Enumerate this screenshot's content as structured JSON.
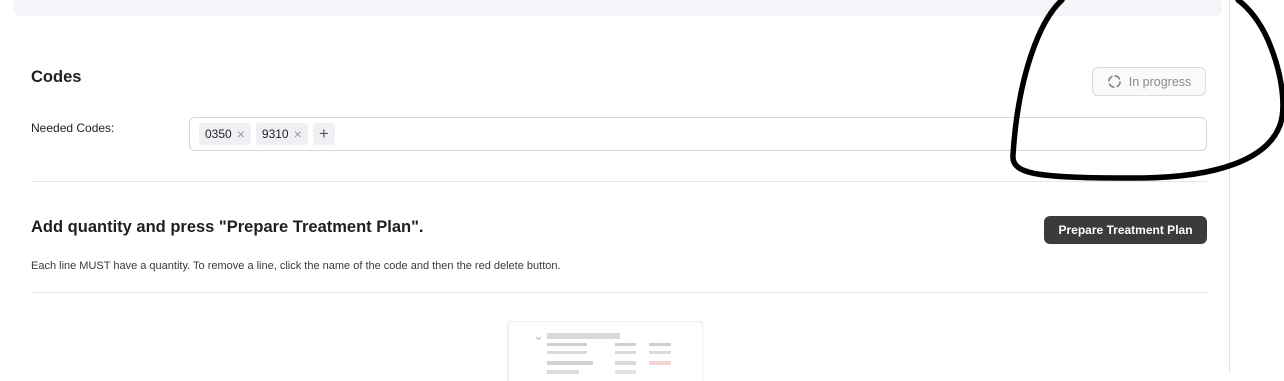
{
  "codes_section": {
    "title": "Codes",
    "status_label": "In progress",
    "needed_codes_label": "Needed Codes:",
    "codes": [
      {
        "code": "0350",
        "remove_icon": "close-icon"
      },
      {
        "code": "9310",
        "remove_icon": "close-icon"
      }
    ],
    "add_icon": "plus-icon"
  },
  "plan_section": {
    "title": "Add quantity and press \"Prepare Treatment Plan\".",
    "help_text": "Each line MUST have a quantity.  To remove a line, click the name of the code and then the red delete button.",
    "prepare_button_label": "Prepare Treatment Plan"
  },
  "empty_state": {
    "icon": "empty-table-illustration"
  },
  "colors": {
    "primary_button_bg": "#3a3b3d",
    "tag_bg": "#eef0f4",
    "status_text": "#8a8a8a",
    "annotation_stroke": "#000000",
    "illustration_accent": "#f7d4d4"
  }
}
